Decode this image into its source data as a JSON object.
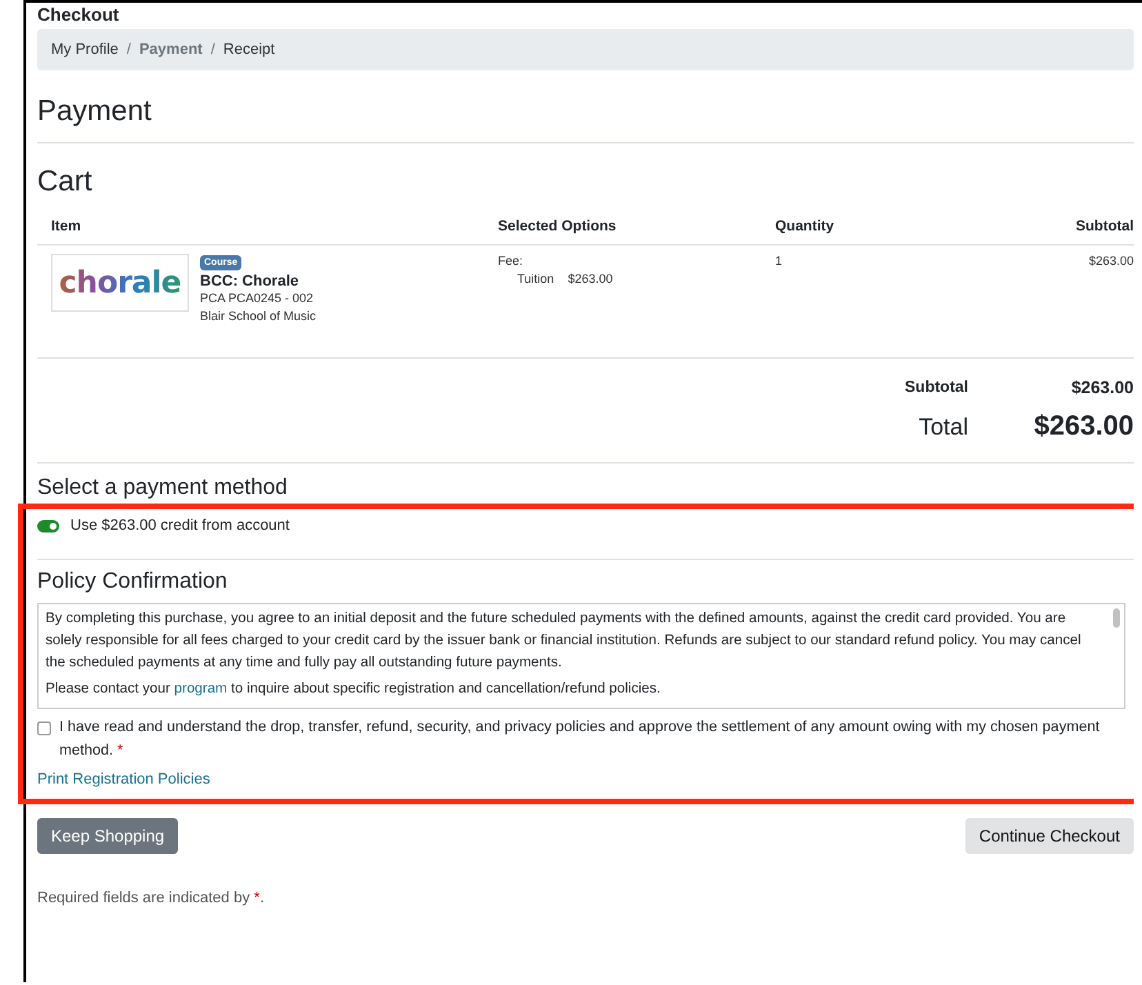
{
  "page_title": "Checkout",
  "breadcrumb": [
    {
      "label": "My Profile",
      "selected": false
    },
    {
      "separator": "/",
      "label": "Payment",
      "selected": true
    },
    {
      "separator": "/",
      "label": "Receipt",
      "selected": false
    }
  ],
  "heading": "Payment",
  "cart": {
    "title": "Cart",
    "columns": [
      "Item",
      "Selected Options",
      "Quantity",
      "Subtotal"
    ],
    "rows": [
      {
        "logo_text": "chorale",
        "badge": "Course",
        "name": "BCC: Chorale",
        "code": "PCA PCA0245 - 002",
        "school": "Blair School of Music",
        "option_label": "Fee:",
        "option_name": "Tuition",
        "option_price": "$263.00",
        "quantity": "1",
        "subtotal": "$263.00"
      }
    ],
    "subtotal_label": "Subtotal",
    "subtotal": "$263.00",
    "total_label": "Total",
    "total": "$263.00"
  },
  "payment": {
    "title": "Select a payment method",
    "credit": {
      "label": "Use $263.00 credit from account",
      "on": true
    }
  },
  "policy": {
    "title": "Policy Confirmation",
    "text": "By completing this purchase, you agree to an initial deposit and the future scheduled payments with the defined amounts, against the credit card provided. You are solely responsible for all fees charged to your credit card by the issuer bank or financial institution. Refunds are subject to our standard refund policy. You may cancel the scheduled payments at any time and fully pay all outstanding future payments.",
    "contact_before": "Please contact your",
    "contact_link": "program",
    "contact_after": "to inquire about specific registration and cancellation/refund policies."
  },
  "agreement": {
    "text": "I have read and understand the drop, transfer, refund, security, and privacy policies and approve the settlement of any amount owing with my chosen payment method.",
    "mark": "*",
    "checked": false
  },
  "print_link": "Print Registration Policies",
  "buttons": [
    {
      "label": "Keep Shopping",
      "kind": "secondary"
    },
    {
      "label": "Continue Checkout",
      "kind": "light"
    }
  ],
  "required_note": {
    "text": "Required fields are indicated by",
    "mark": "*",
    "end": "."
  }
}
